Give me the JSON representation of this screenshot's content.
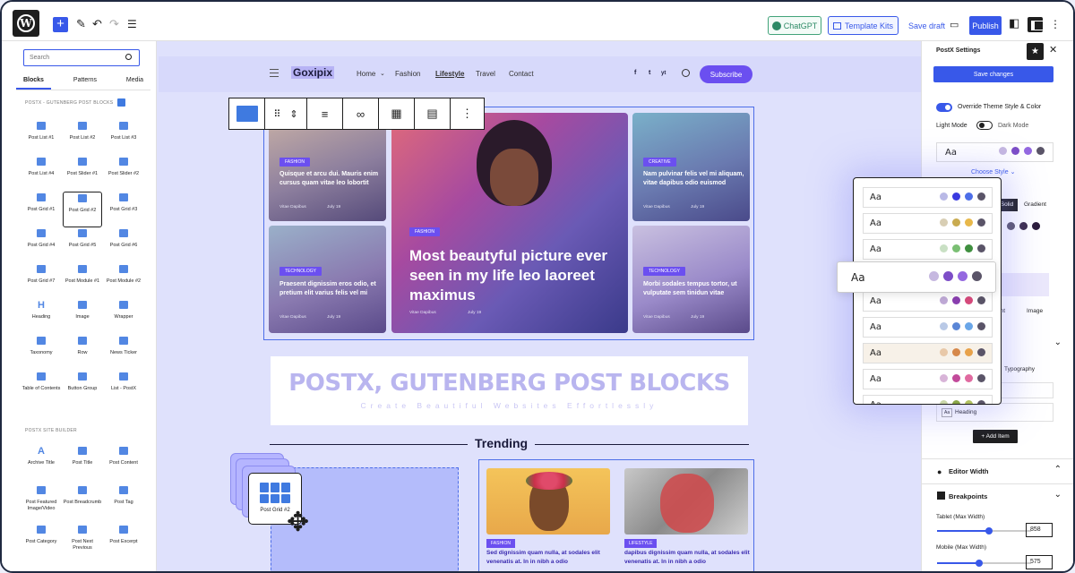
{
  "topbar": {
    "undo_label": "undo",
    "chatgpt_label": "ChatGPT",
    "template_kits_label": "Template Kits",
    "save_draft_label": "Save draft",
    "publish_label": "Publish"
  },
  "left_sidebar": {
    "search_placeholder": "Search",
    "tabs": [
      "Blocks",
      "Patterns",
      "Media"
    ],
    "section_blocks_title": "POSTX - GUTENBERG POST BLOCKS",
    "blocks": [
      "Post List #1",
      "Post List #2",
      "Post List #3",
      "Post List #4",
      "Post Slider #1",
      "Post Slider #2",
      "Post Grid #1",
      "Post Grid #2",
      "Post Grid #3",
      "Post Grid #4",
      "Post Grid #5",
      "Post Grid #6",
      "Post Grid #7",
      "Post Module #1",
      "Post Module #2",
      "Heading",
      "Image",
      "Wrapper",
      "Taxonomy",
      "Row",
      "News Ticker",
      "Table of Contents",
      "Button Group",
      "List - PostX"
    ],
    "section_site_builder_title": "POSTX SITE BUILDER",
    "site_builder_blocks": [
      "Archive Title",
      "Post Title",
      "Post Content",
      "Post Featured Image/Video",
      "Post Breadcrumb",
      "Post Tag",
      "Post Category",
      "Post Next Previous",
      "Post Excerpt"
    ]
  },
  "site": {
    "logo": "Goxipix",
    "menu": [
      "Home",
      "Fashion",
      "Lifestyle",
      "Travel",
      "Contact"
    ],
    "menu_active": "Lifestyle",
    "social": [
      "f",
      "t",
      "yt"
    ],
    "subscribe_label": "Subscribe",
    "grid": [
      {
        "badge": "FASHION",
        "title": "Quisque et arcu dui. Mauris enim cursus quam vitae leo lobortit",
        "author": "Vitae Dapibus",
        "date": "July 19"
      },
      {
        "badge": "FASHION",
        "title": "Most beautyful picture ever seen in my life leo laoreet maximus",
        "author": "Vitae Dapibus",
        "date": "July 19"
      },
      {
        "badge": "CREATIVE",
        "title": "Nam pulvinar felis vel mi aliquam, vitae dapibus odio euismod",
        "author": "Vitae Dapibus",
        "date": "July 19"
      },
      {
        "badge": "TECHNOLOGY",
        "title": "Praesent dignissim eros odio, et pretium elit varius felis vel mi",
        "author": "Vitae Dapibus",
        "date": "July 19"
      },
      {
        "badge": "TECHNOLOGY",
        "title": "Morbi sodales tempus tortor, ut vulputate sem tinidun vitae",
        "author": "Vitae Dapibus",
        "date": "July 19"
      }
    ],
    "heading_title": "POSTX, GUTENBERG POST BLOCKS",
    "heading_subtitle": "Create Beautiful Websites Effortlessly",
    "trending_label": "Trending",
    "drag_card_label": "Post Grid #2",
    "trending_posts": [
      {
        "badge": "FASHION",
        "title": "Sed dignissim quam nulla, at sodales elit venenatis at. In in nibh a odio"
      },
      {
        "badge": "LIFESTYLE",
        "title": "dapibus dignissim quam nulla, at sodales elit venenatis at. In in nibh a odio"
      }
    ]
  },
  "style_popover": {
    "sample_text": "Aa",
    "palettes": [
      [
        "#b9b9e6",
        "#3a3ae0",
        "#4d6ee8",
        "#5a5468"
      ],
      [
        "#d8ceb4",
        "#c9ab50",
        "#e8b84a",
        "#5a5468"
      ],
      [
        "#c9e0c4",
        "#7abf73",
        "#3f8f3f",
        "#5a5468"
      ],
      [
        "#c6b8e0",
        "#7d4ec7",
        "#9468e0",
        "#5a5468"
      ],
      [
        "#bfa9d6",
        "#8a3fb0",
        "#d64a7c",
        "#5a5468"
      ],
      [
        "#b9c9e6",
        "#5a86d6",
        "#6aa6e8",
        "#5a5468"
      ],
      [
        "#e8c8a8",
        "#d6884a",
        "#e8a24a",
        "#5a5468"
      ],
      [
        "#d8b4d8",
        "#c24a9a",
        "#e06aa0",
        "#5a5468"
      ],
      [
        "#c9d6a8",
        "#8aa64a",
        "#b0c060",
        "#5a5468"
      ]
    ],
    "active_index": 3
  },
  "right_sidebar": {
    "title": "PostX Settings",
    "save_changes_label": "Save changes",
    "override_label": "Override Theme Style & Color",
    "light_mode_label": "Light Mode",
    "dark_mode_label": "Dark Mode",
    "preview_sample": "Aa",
    "preview_palette": [
      "#c6b8e0",
      "#7d4ec7",
      "#9468e0",
      "#5a5468"
    ],
    "choose_style_label": "Choose Style",
    "solid_label": "Solid",
    "gradient_label": "Gradient",
    "bg_palette": [
      "#5a5468",
      "#3a2a4a",
      "#2a1a3a"
    ],
    "partial_ent": "ent",
    "image_label": "Image",
    "typography_label": "Typography",
    "heading_item_label": "Heading",
    "heading_item_sample": "Aa",
    "add_item_label": "Add Item",
    "editor_width_label": "Editor Width",
    "breakpoints_label": "Breakpoints",
    "tablet_label": "Tablet (Max Width)",
    "tablet_value": "858",
    "tablet_fill": 0.55,
    "mobile_label": "Mobile (Max Width)",
    "mobile_value": "575",
    "mobile_fill": 0.45
  }
}
